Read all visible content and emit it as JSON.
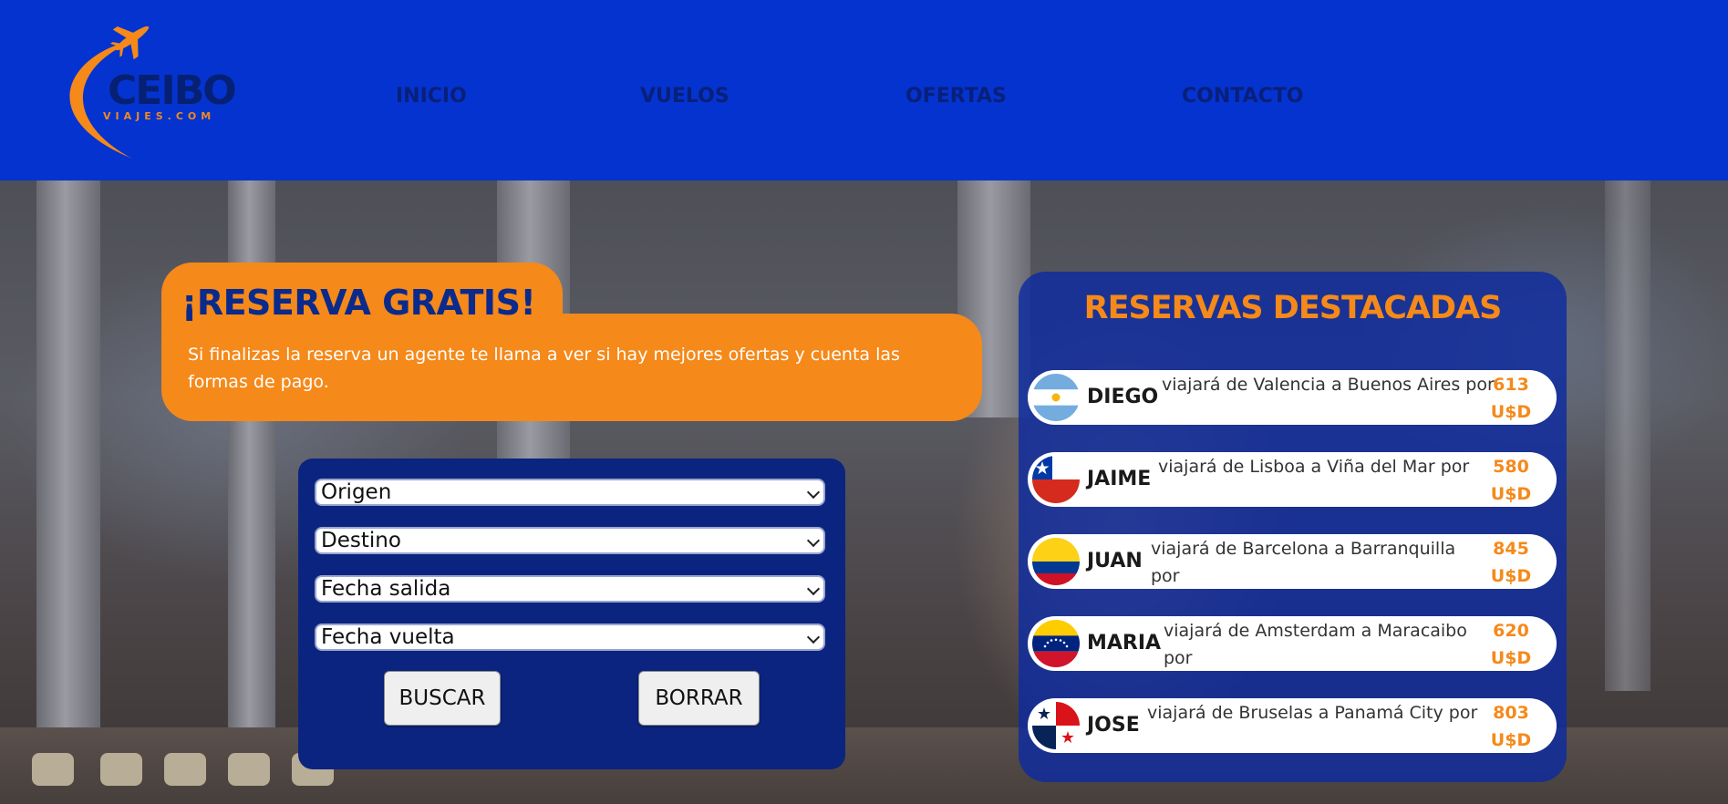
{
  "brand": {
    "name": "CEIBO",
    "subtitle": "VIAJES.COM",
    "colors": {
      "header_bg": "#0533cf",
      "accent": "#f5891a",
      "navy": "#0b2480"
    }
  },
  "nav": {
    "items": [
      {
        "label": "INICIO"
      },
      {
        "label": "VUELOS"
      },
      {
        "label": "OFERTAS"
      },
      {
        "label": "CONTACTO"
      }
    ]
  },
  "reserva": {
    "title": "¡RESERVA GRATIS!",
    "text": "Si finalizas la reserva un agente te llama a ver si hay mejores ofertas y cuenta las formas de pago."
  },
  "search": {
    "fields": [
      {
        "selected": "Origen"
      },
      {
        "selected": "Destino"
      },
      {
        "selected": "Fecha salida"
      },
      {
        "selected": "Fecha vuelta"
      }
    ],
    "buscar_label": "BUSCAR",
    "borrar_label": "BORRAR"
  },
  "destacadas": {
    "title": "RESERVAS DESTACADAS",
    "rows": [
      {
        "flag": "argentina-flag-icon",
        "name": "DIEGO",
        "desc": "viajará de Valencia a Buenos Aires por",
        "price": "613",
        "currency": "U$D"
      },
      {
        "flag": "chile-flag-icon",
        "name": "JAIME",
        "desc": "viajará de Lisboa a Viña del Mar por",
        "price": "580",
        "currency": "U$D"
      },
      {
        "flag": "colombia-flag-icon",
        "name": "JUAN",
        "desc": "viajará de Barcelona a Barranquilla por",
        "price": "845",
        "currency": "U$D"
      },
      {
        "flag": "venezuela-flag-icon",
        "name": "MARIA",
        "desc": "viajará de Amsterdam a Maracaibo por",
        "price": "620",
        "currency": "U$D"
      },
      {
        "flag": "panama-flag-icon",
        "name": "JOSE",
        "desc": "viajará de Bruselas a Panamá City por",
        "price": "803",
        "currency": "U$D"
      }
    ]
  }
}
